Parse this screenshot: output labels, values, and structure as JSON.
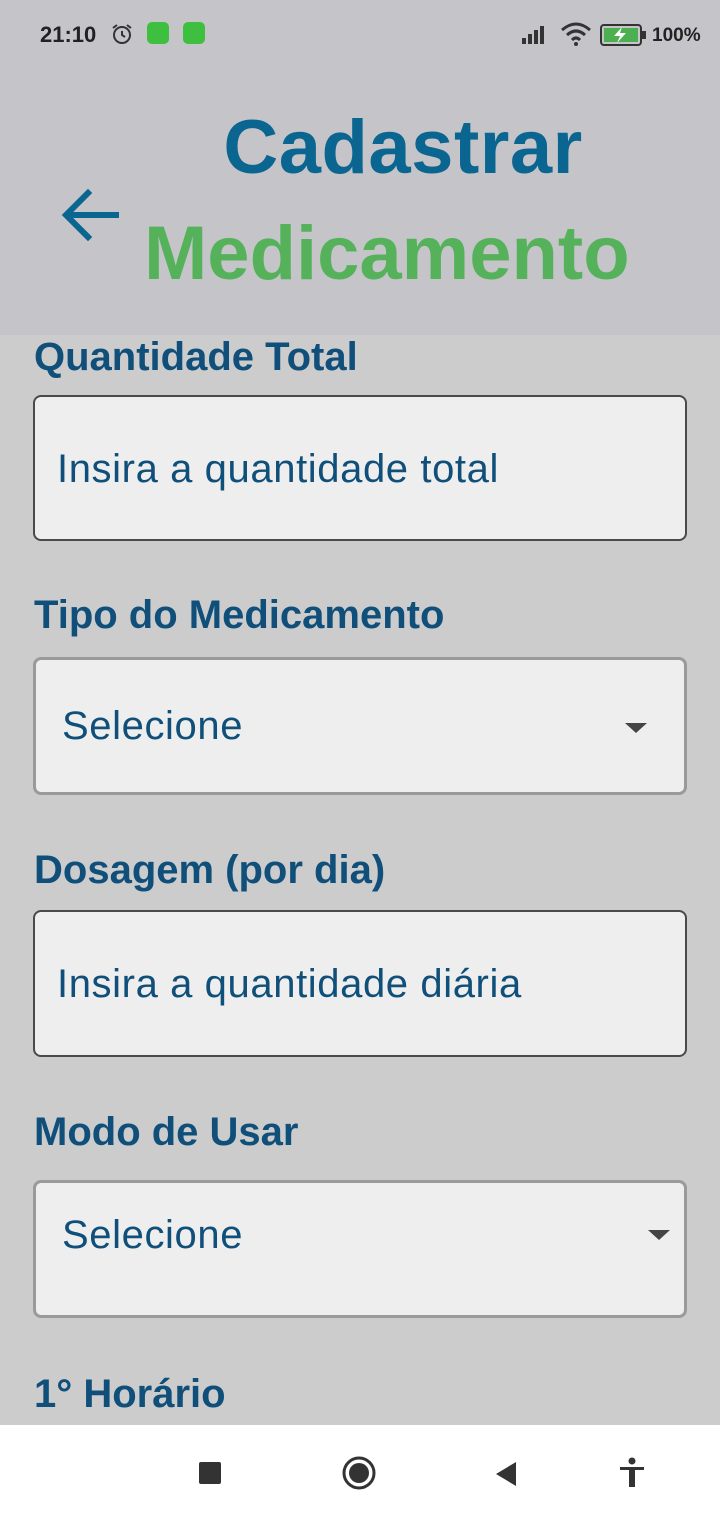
{
  "status_bar": {
    "time": "21:10",
    "battery": "100%",
    "icons": [
      "alarm-icon",
      "app-badge-icon",
      "app-badge-icon",
      "signal-icon",
      "wifi-icon",
      "battery-charging-icon"
    ]
  },
  "header": {
    "title_line1": "Cadastrar",
    "title_line2": "Medicamento",
    "back_icon": "arrow-left-icon"
  },
  "form": {
    "quantidade_label": "Quantidade Total",
    "quantidade_placeholder": "Insira a quantidade total",
    "tipo_label": "Tipo do Medicamento",
    "tipo_value": "Selecione",
    "dosagem_label": "Dosagem (por dia)",
    "dosagem_placeholder": "Insira a quantidade diária",
    "modo_label": "Modo de Usar",
    "modo_value": "Selecione",
    "horario_label": "1° Horário"
  },
  "colors": {
    "title_blue": "#0a6690",
    "title_green": "#56b25a",
    "label_blue": "#0f4f7a",
    "header_bg": "#c4c4c9",
    "content_bg": "#cccccc"
  },
  "nav_bar": {
    "icons": [
      "recents-square-icon",
      "home-circle-icon",
      "back-triangle-icon",
      "accessibility-icon"
    ]
  }
}
